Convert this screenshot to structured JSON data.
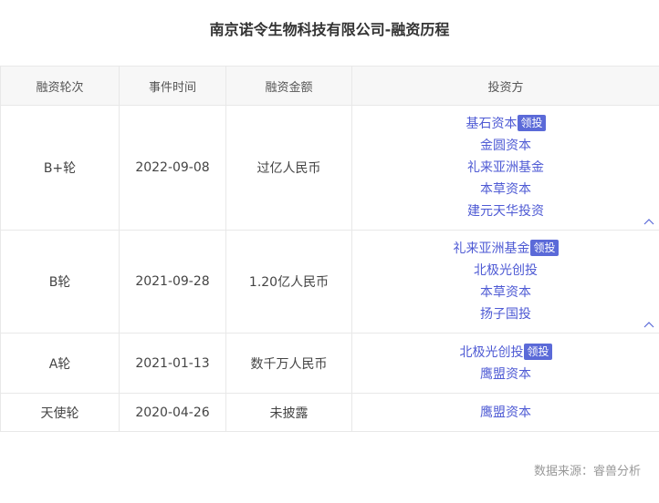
{
  "title": "南京诺令生物科技有限公司-融资历程",
  "headers": {
    "round": "融资轮次",
    "date": "事件时间",
    "amount": "融资金额",
    "investors": "投资方"
  },
  "lead_badge": "领投",
  "rows": [
    {
      "round": "B+轮",
      "date": "2022-09-08",
      "amount": "过亿人民币",
      "investors": [
        {
          "name": "基石资本",
          "lead": true
        },
        {
          "name": "金圆资本",
          "lead": false
        },
        {
          "name": "礼来亚洲基金",
          "lead": false
        },
        {
          "name": "本草资本",
          "lead": false
        },
        {
          "name": "建元天华投资",
          "lead": false
        }
      ],
      "collapsible": true
    },
    {
      "round": "B轮",
      "date": "2021-09-28",
      "amount": "1.20亿人民币",
      "investors": [
        {
          "name": "礼来亚洲基金",
          "lead": true
        },
        {
          "name": "北极光创投",
          "lead": false
        },
        {
          "name": "本草资本",
          "lead": false
        },
        {
          "name": "扬子国投",
          "lead": false
        }
      ],
      "collapsible": true
    },
    {
      "round": "A轮",
      "date": "2021-01-13",
      "amount": "数千万人民币",
      "investors": [
        {
          "name": "北极光创投",
          "lead": true
        },
        {
          "name": "鹰盟资本",
          "lead": false
        }
      ],
      "collapsible": false
    },
    {
      "round": "天使轮",
      "date": "2020-04-26",
      "amount": "未披露",
      "investors": [
        {
          "name": "鹰盟资本",
          "lead": false
        }
      ],
      "collapsible": false
    }
  ],
  "source": "数据来源：睿兽分析",
  "colors": {
    "investor_link": "#4e5ad4",
    "lead_badge_bg": "#5b6ad8",
    "header_bg": "#f7f7f7"
  },
  "icons": {
    "collapse": "chevron-up-icon"
  }
}
